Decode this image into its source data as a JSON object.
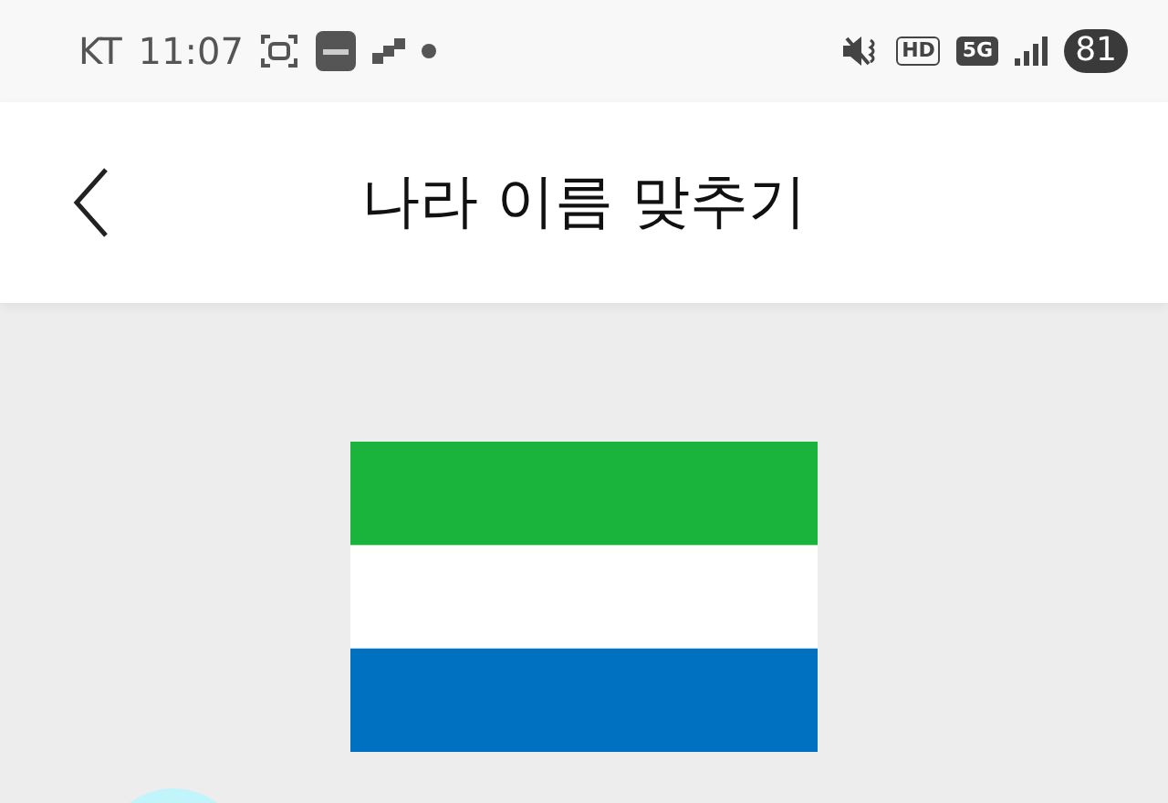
{
  "status_bar": {
    "carrier": "KT",
    "time": "11:07",
    "badges": [
      "HD",
      "5G"
    ],
    "battery": "81"
  },
  "header": {
    "title": "나라 이름 맞추기"
  },
  "flag": {
    "stripes": [
      {
        "color": "#1ab43c"
      },
      {
        "color": "#ffffff"
      },
      {
        "color": "#0070c0"
      }
    ]
  }
}
